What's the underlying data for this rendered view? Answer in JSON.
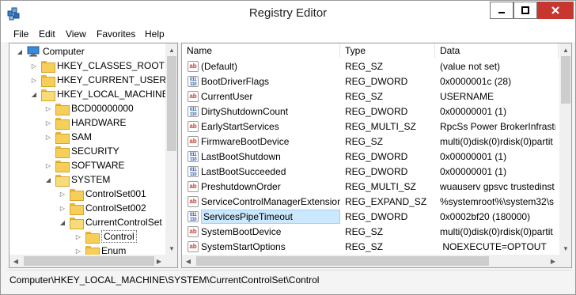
{
  "window": {
    "title": "Registry Editor"
  },
  "menu": [
    "File",
    "Edit",
    "View",
    "Favorites",
    "Help"
  ],
  "tree": [
    {
      "label": "Computer",
      "level": 0,
      "expander": "down",
      "icon": "computer"
    },
    {
      "label": "HKEY_CLASSES_ROOT",
      "level": 1,
      "expander": "right"
    },
    {
      "label": "HKEY_CURRENT_USER",
      "level": 1,
      "expander": "right"
    },
    {
      "label": "HKEY_LOCAL_MACHINE",
      "level": 1,
      "expander": "down"
    },
    {
      "label": "BCD00000000",
      "level": 2,
      "expander": "right"
    },
    {
      "label": "HARDWARE",
      "level": 2,
      "expander": "right"
    },
    {
      "label": "SAM",
      "level": 2,
      "expander": "right"
    },
    {
      "label": "SECURITY",
      "level": 2,
      "expander": "none"
    },
    {
      "label": "SOFTWARE",
      "level": 2,
      "expander": "right"
    },
    {
      "label": "SYSTEM",
      "level": 2,
      "expander": "down"
    },
    {
      "label": "ControlSet001",
      "level": 3,
      "expander": "right"
    },
    {
      "label": "ControlSet002",
      "level": 3,
      "expander": "right"
    },
    {
      "label": "CurrentControlSet",
      "level": 3,
      "expander": "down"
    },
    {
      "label": "Control",
      "level": 4,
      "expander": "right",
      "selected": true
    },
    {
      "label": "Enum",
      "level": 4,
      "expander": "right"
    }
  ],
  "list": {
    "columns": [
      "Name",
      "Type",
      "Data"
    ],
    "rows": [
      {
        "name": "(Default)",
        "type": "REG_SZ",
        "data": "(value not set)",
        "icon": "string"
      },
      {
        "name": "BootDriverFlags",
        "type": "REG_DWORD",
        "data": "0x0000001c (28)",
        "icon": "binary"
      },
      {
        "name": "CurrentUser",
        "type": "REG_SZ",
        "data": "USERNAME",
        "icon": "string"
      },
      {
        "name": "DirtyShutdownCount",
        "type": "REG_DWORD",
        "data": "0x00000001 (1)",
        "icon": "binary"
      },
      {
        "name": "EarlyStartServices",
        "type": "REG_MULTI_SZ",
        "data": "RpcSs Power BrokerInfrastru",
        "icon": "string"
      },
      {
        "name": "FirmwareBootDevice",
        "type": "REG_SZ",
        "data": "multi(0)disk(0)rdisk(0)partit",
        "icon": "string"
      },
      {
        "name": "LastBootShutdown",
        "type": "REG_DWORD",
        "data": "0x00000001 (1)",
        "icon": "binary"
      },
      {
        "name": "LastBootSucceeded",
        "type": "REG_DWORD",
        "data": "0x00000001 (1)",
        "icon": "binary"
      },
      {
        "name": "PreshutdownOrder",
        "type": "REG_MULTI_SZ",
        "data": "wuauserv gpsvc trustedinst",
        "icon": "string"
      },
      {
        "name": "ServiceControlManagerExtension",
        "type": "REG_EXPAND_SZ",
        "data": "%systemroot%\\system32\\s",
        "icon": "string"
      },
      {
        "name": "ServicesPipeTimeout",
        "type": "REG_DWORD",
        "data": "0x0002bf20 (180000)",
        "icon": "binary",
        "selected": true
      },
      {
        "name": "SystemBootDevice",
        "type": "REG_SZ",
        "data": "multi(0)disk(0)rdisk(0)partit",
        "icon": "string"
      },
      {
        "name": "SystemStartOptions",
        "type": "REG_SZ",
        "data": " NOEXECUTE=OPTOUT",
        "icon": "string"
      }
    ]
  },
  "status": {
    "path": "Computer\\HKEY_LOCAL_MACHINE\\SYSTEM\\CurrentControlSet\\Control"
  },
  "colors": {
    "close_button": "#c7372f",
    "selection": "#cce8ff",
    "folder": "#f5cf5a"
  }
}
